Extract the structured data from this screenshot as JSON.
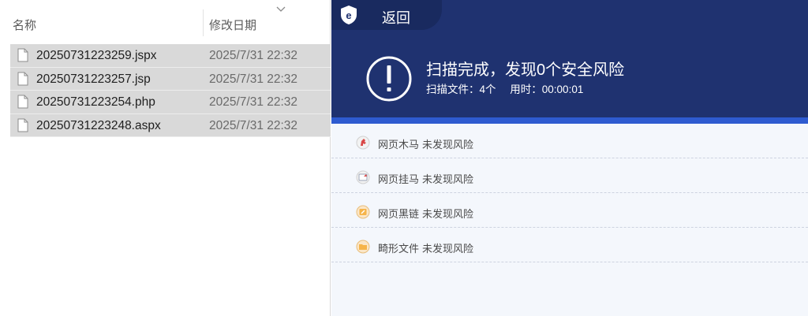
{
  "explorer": {
    "columns": {
      "name": "名称",
      "date": "修改日期"
    },
    "files": [
      {
        "name": "20250731223259.jspx",
        "date": "2025/7/31 22:32"
      },
      {
        "name": "20250731223257.jsp",
        "date": "2025/7/31 22:32"
      },
      {
        "name": "20250731223254.php",
        "date": "2025/7/31 22:32"
      },
      {
        "name": "20250731223248.aspx",
        "date": "2025/7/31 22:32"
      }
    ]
  },
  "scanner": {
    "back_label": "返回",
    "summary_title": "扫描完成，发现0个安全风险",
    "files_scanned": "扫描文件：4个",
    "time_used": "用时：00:00:01",
    "results": [
      {
        "category": "网页木马",
        "status": "未发现风险",
        "icon": "trojan-icon"
      },
      {
        "category": "网页挂马",
        "status": "未发现风险",
        "icon": "hanging-horse-icon"
      },
      {
        "category": "网页黑链",
        "status": "未发现风险",
        "icon": "black-link-icon"
      },
      {
        "category": "畸形文件",
        "status": "未发现风险",
        "icon": "malformed-file-icon"
      }
    ],
    "colors": {
      "header": "#1f3270",
      "accent": "#2e5bd0"
    }
  }
}
